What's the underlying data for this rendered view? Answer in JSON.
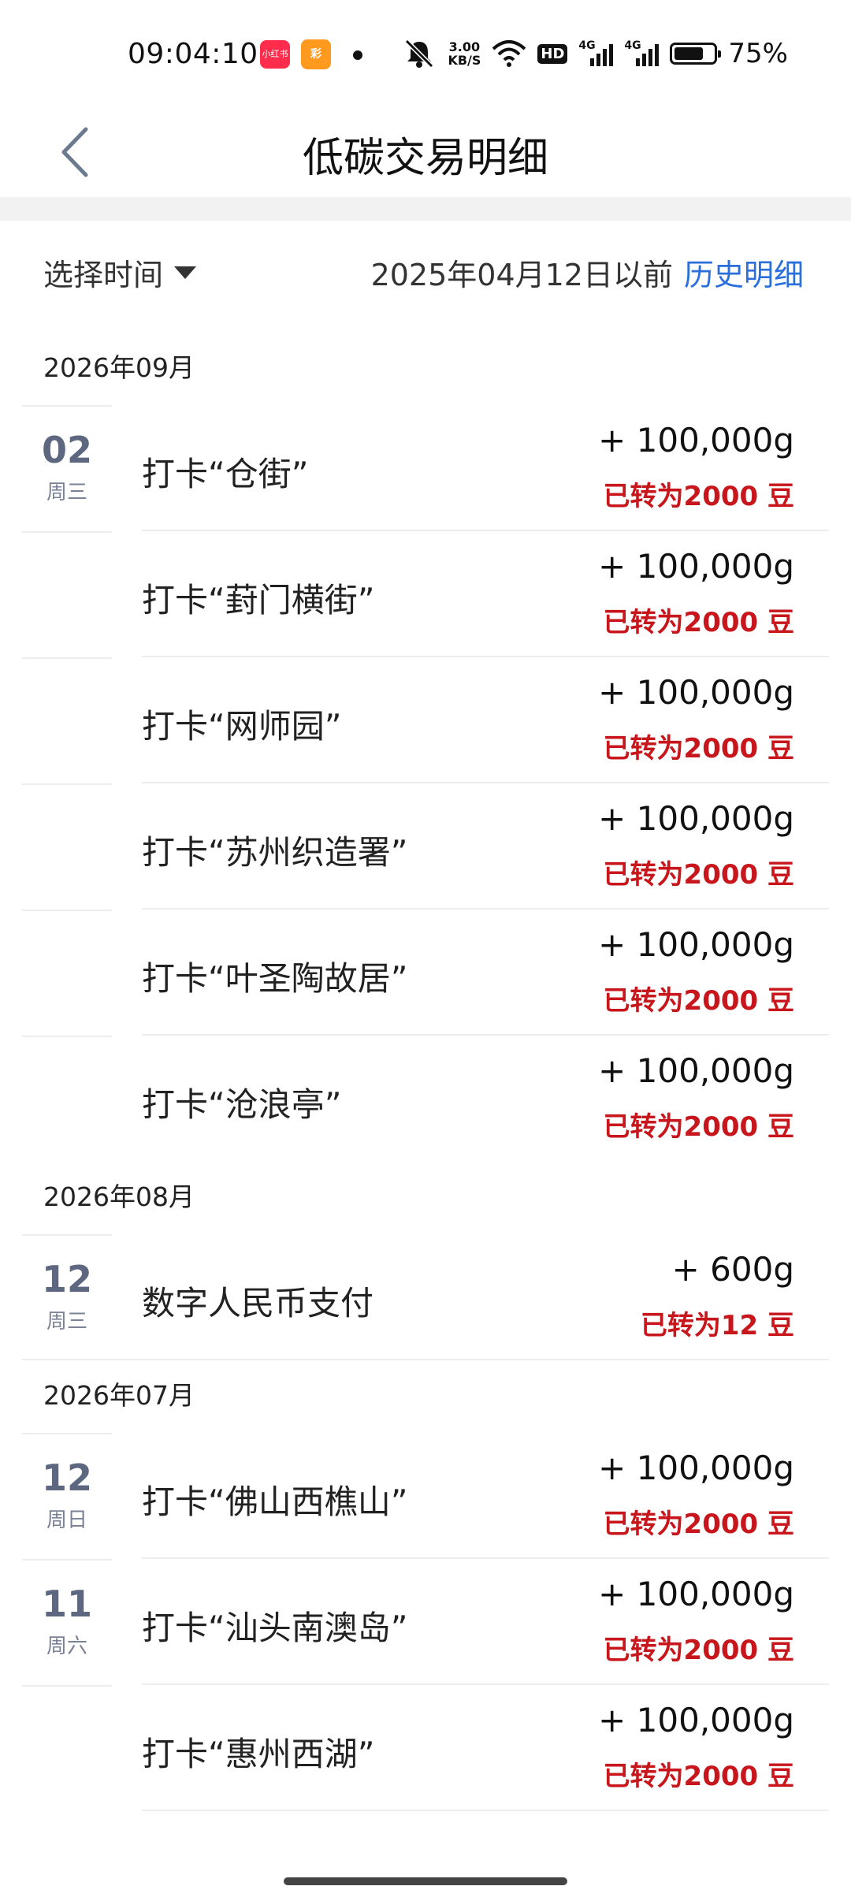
{
  "status_bar": {
    "time": "09:04:10",
    "app1_label": "小红书",
    "app2_label": "彩",
    "speed": [
      "3.00",
      "KB/S"
    ],
    "hd_label": "HD",
    "signal1_label": "4G",
    "signal2_label": "4G",
    "battery_percent": 75,
    "battery_label": "75%"
  },
  "header": {
    "title": "低碳交易明细",
    "back_icon": "chevron-left-icon"
  },
  "filter": {
    "select_label": "选择时间",
    "date_note": "2025年04月12日以前",
    "history_link": "历史明细"
  },
  "colors": {
    "accent_blue": "#2a6fdb",
    "converted_red": "#c8161d",
    "date_gray": "#5d6880"
  },
  "months": [
    {
      "label": "2026年09月",
      "rows": [
        {
          "day": "02",
          "weekday": "周三",
          "title": "打卡“仓街”",
          "amount": "+ 100,000g",
          "converted": "已转为2000 豆"
        },
        {
          "day": "",
          "weekday": "",
          "title": "打卡“葑门横街”",
          "amount": "+ 100,000g",
          "converted": "已转为2000 豆"
        },
        {
          "day": "",
          "weekday": "",
          "title": "打卡“网师园”",
          "amount": "+ 100,000g",
          "converted": "已转为2000 豆"
        },
        {
          "day": "",
          "weekday": "",
          "title": "打卡“苏州织造署”",
          "amount": "+ 100,000g",
          "converted": "已转为2000 豆"
        },
        {
          "day": "",
          "weekday": "",
          "title": "打卡“叶圣陶故居”",
          "amount": "+ 100,000g",
          "converted": "已转为2000 豆"
        },
        {
          "day": "",
          "weekday": "",
          "title": "打卡“沧浪亭”",
          "amount": "+ 100,000g",
          "converted": "已转为2000 豆"
        }
      ]
    },
    {
      "label": "2026年08月",
      "rows": [
        {
          "day": "12",
          "weekday": "周三",
          "title": "数字人民币支付",
          "amount": "+ 600g",
          "converted": "已转为12 豆"
        }
      ]
    },
    {
      "label": "2026年07月",
      "rows": [
        {
          "day": "12",
          "weekday": "周日",
          "title": "打卡“佛山西樵山”",
          "amount": "+ 100,000g",
          "converted": "已转为2000 豆"
        },
        {
          "day": "11",
          "weekday": "周六",
          "title": "打卡“汕头南澳岛”",
          "amount": "+ 100,000g",
          "converted": "已转为2000 豆"
        },
        {
          "day": "",
          "weekday": "",
          "title": "打卡“惠州西湖”",
          "amount": "+ 100,000g",
          "converted": "已转为2000 豆"
        }
      ]
    }
  ]
}
